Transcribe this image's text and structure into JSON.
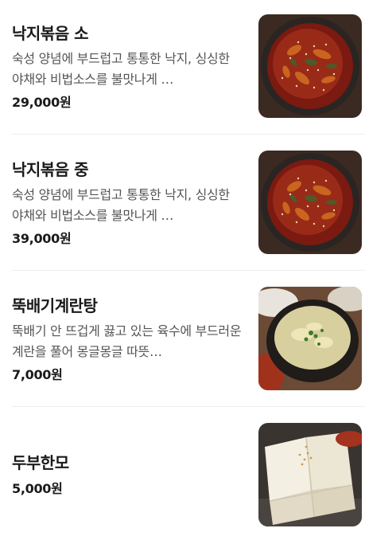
{
  "menu": {
    "items": [
      {
        "name": "낙지볶음 소",
        "description": "숙성 양념에 부드럽고 통통한 낙지, 싱싱한 야채와 비법소스를 불맛나게 …",
        "price": "29,000원"
      },
      {
        "name": "낙지볶음 중",
        "description": "숙성 양념에 부드럽고 통통한 낙지, 싱싱한 야채와 비법소스를 불맛나게 …",
        "price": "39,000원"
      },
      {
        "name": "뚝배기계란탕",
        "description": "뚝배기 안 뜨겁게 끓고 있는 육수에 부드러운 계란을 풀어 몽글몽글 따뜻…",
        "price": "7,000원"
      },
      {
        "name": "두부한모",
        "price": "5,000원"
      }
    ]
  },
  "colors": {
    "sauce_red": "#8e1f14",
    "pot_black": "#2a2522",
    "tofu_white": "#f3efe2",
    "divider": "#eeeeee"
  }
}
